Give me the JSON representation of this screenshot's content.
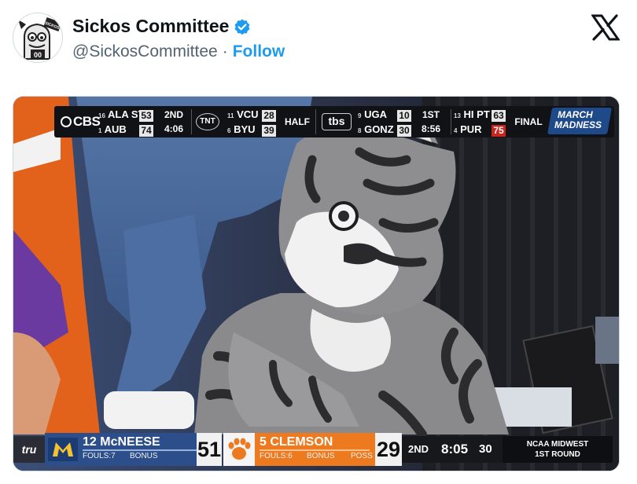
{
  "tweet": {
    "display_name": "Sickos Committee",
    "handle": "@SickosCommittee",
    "separator": "·",
    "follow_label": "Follow",
    "avatar_text": "00",
    "avatar_banner": "SICKOS",
    "verified_icon": "verified-badge-icon",
    "brand_icon": "x-logo-icon",
    "accent_color": "#1d9bf0"
  },
  "ticker": {
    "network_1": "CBS",
    "game_1": {
      "team_a_seed": "16",
      "team_a": "ALA ST",
      "team_a_score": "53",
      "team_b_seed": "1",
      "team_b": "AUB",
      "team_b_score": "74",
      "period": "2ND",
      "clock": "4:06"
    },
    "network_2": "TNT",
    "game_2": {
      "team_a_seed": "11",
      "team_a": "VCU",
      "team_a_score": "28",
      "team_b_seed": "6",
      "team_b": "BYU",
      "team_b_score": "39",
      "status": "HALF"
    },
    "network_3": "tbs",
    "game_3": {
      "team_a_seed": "9",
      "team_a": "UGA",
      "team_a_score": "10",
      "team_b_seed": "8",
      "team_b": "GONZ",
      "team_b_score": "30",
      "period": "1ST",
      "clock": "8:56"
    },
    "game_4": {
      "team_a_seed": "13",
      "team_a": "HI PT",
      "team_a_score": "63",
      "team_b_seed": "4",
      "team_b": "PUR",
      "team_b_score": "75",
      "status": "FINAL"
    },
    "logo_line_1": "MARCH",
    "logo_line_2": "MADNESS"
  },
  "scorebug": {
    "network": "tru",
    "team_1": {
      "seed_name": "12 McNEESE",
      "fouls": "FOULS:7",
      "bonus": "BONUS",
      "score": "51",
      "color": "#2c4f8c"
    },
    "team_2": {
      "seed_name": "5 CLEMSON",
      "fouls": "FOULS:6",
      "bonus": "BONUS",
      "poss": "POSS",
      "score": "29",
      "color": "#ed7a1e"
    },
    "period": "2ND",
    "clock": "8:05",
    "shot_clock": "30",
    "round_line_1": "NCAA MIDWEST",
    "round_line_2": "1ST ROUND"
  }
}
